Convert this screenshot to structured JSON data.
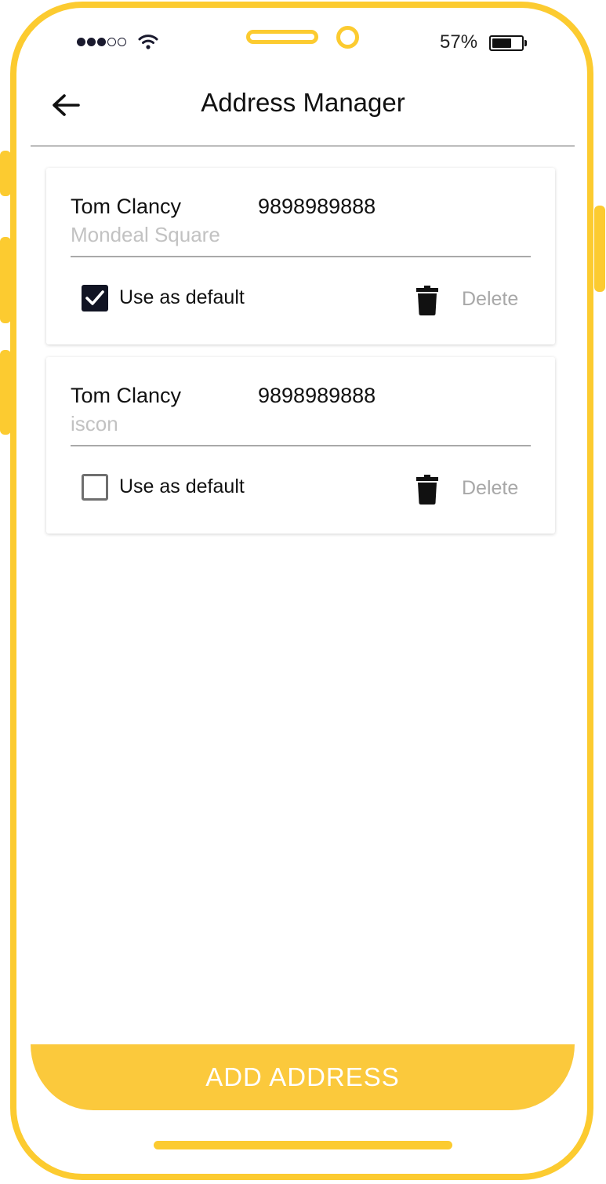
{
  "status_bar": {
    "signal": {
      "filled": 3,
      "total": 5
    },
    "battery_percent_label": "57%",
    "battery_level": 0.57
  },
  "header": {
    "back_icon": "arrow-left-icon",
    "title": "Address Manager"
  },
  "addresses": [
    {
      "name": "Tom Clancy",
      "phone": "9898989888",
      "address": "Mondeal Square",
      "default_label": "Use as default",
      "is_default": true,
      "delete_label": "Delete"
    },
    {
      "name": "Tom Clancy",
      "phone": "9898989888",
      "address": "iscon",
      "default_label": "Use as default",
      "is_default": false,
      "delete_label": "Delete"
    }
  ],
  "add_button": {
    "label": "ADD ADDRESS"
  },
  "colors": {
    "accent": "#fccb30",
    "button": "#fbc93c",
    "checkbox_checked": "#111423",
    "muted_text": "#a8a8a8"
  }
}
